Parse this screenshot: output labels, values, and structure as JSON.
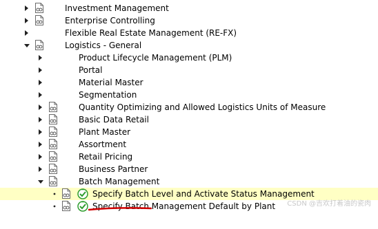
{
  "tree": {
    "rows": [
      {
        "label": "Investment Management",
        "state": "collapsed",
        "level": 0,
        "doc": true
      },
      {
        "label": "Enterprise Controlling",
        "state": "collapsed",
        "level": 0,
        "doc": true
      },
      {
        "label": "Flexible Real Estate Management (RE-FX)",
        "state": "collapsed",
        "level": 0,
        "doc": false
      },
      {
        "label": "Logistics - General",
        "state": "expanded",
        "level": 0,
        "doc": true
      },
      {
        "label": "Product Lifecycle Management (PLM)",
        "state": "collapsed",
        "level": 1,
        "doc": false
      },
      {
        "label": "Portal",
        "state": "collapsed",
        "level": 1,
        "doc": false
      },
      {
        "label": "Material Master",
        "state": "collapsed",
        "level": 1,
        "doc": false
      },
      {
        "label": "Segmentation",
        "state": "collapsed",
        "level": 1,
        "doc": false
      },
      {
        "label": "Quantity Optimizing and Allowed Logistics Units of Measure",
        "state": "collapsed",
        "level": 1,
        "doc": true
      },
      {
        "label": "Basic Data Retail",
        "state": "collapsed",
        "level": 1,
        "doc": true
      },
      {
        "label": "Plant Master",
        "state": "collapsed",
        "level": 1,
        "doc": true
      },
      {
        "label": "Assortment",
        "state": "collapsed",
        "level": 1,
        "doc": true
      },
      {
        "label": "Retail Pricing",
        "state": "collapsed",
        "level": 1,
        "doc": true
      },
      {
        "label": "Business Partner",
        "state": "collapsed",
        "level": 1,
        "doc": true
      },
      {
        "label": "Batch Management",
        "state": "expanded",
        "level": 1,
        "doc": true
      },
      {
        "label": "Specify Batch Level and Activate Status Management",
        "state": "leaf",
        "level": 2,
        "doc": true,
        "exec": true,
        "selected": true
      },
      {
        "label": "Specify Batch Management Default by Plant",
        "state": "leaf",
        "level": 2,
        "doc": true,
        "exec": true
      }
    ]
  },
  "watermark": "CSDN @吉欢打着油的瓷肉",
  "colors": {
    "selected_row": "#ffffc4",
    "annotation_underline": "#d00000",
    "exec_icon": "#2e9e2e"
  }
}
